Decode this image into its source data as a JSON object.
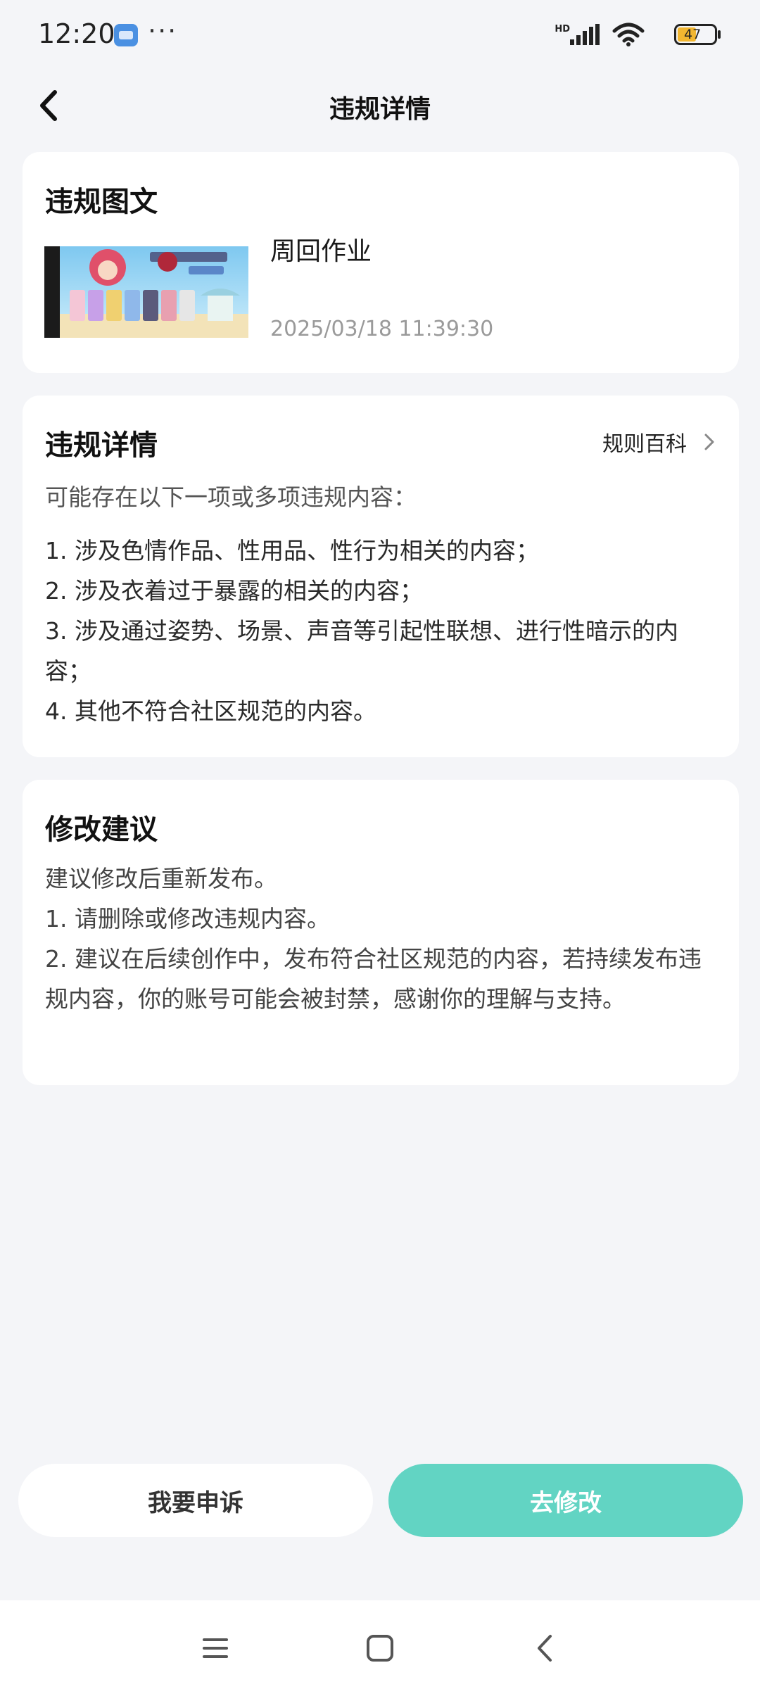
{
  "status_bar": {
    "time": "12:20",
    "more": "···",
    "hd": "HD",
    "battery": "47",
    "icons": [
      "app-notification-icon",
      "signal-icon",
      "wifi-icon",
      "battery-icon"
    ]
  },
  "header": {
    "title": "违规详情",
    "back_icon": "back-arrow-icon"
  },
  "post_card": {
    "title": "违规图文",
    "post_name": "周回作业",
    "post_time": "2025/03/18 11:39:30"
  },
  "detail_card": {
    "title": "违规详情",
    "rules_link": "规则百科",
    "intro": "可能存在以下一项或多项违规内容：",
    "items": [
      "1. 涉及色情作品、性用品、性行为相关的内容；",
      "2. 涉及衣着过于暴露的相关的内容；",
      "3. 涉及通过姿势、场景、声音等引起性联想、进行性暗示的内容；",
      "4. 其他不符合社区规范的内容。"
    ]
  },
  "suggest_card": {
    "title": "修改建议",
    "lines": [
      "建议修改后重新发布。",
      "1. 请删除或修改违规内容。",
      "2. 建议在后续创作中，发布符合社区规范的内容，若持续发布违规内容，你的账号可能会被封禁，感谢你的理解与支持。"
    ]
  },
  "actions": {
    "appeal": "我要申诉",
    "edit": "去修改"
  },
  "colors": {
    "background": "#f4f5f8",
    "accent": "#62d4c3",
    "card": "#ffffff"
  },
  "system_nav": {
    "icons": [
      "menu-icon",
      "home-icon",
      "back-icon"
    ]
  }
}
